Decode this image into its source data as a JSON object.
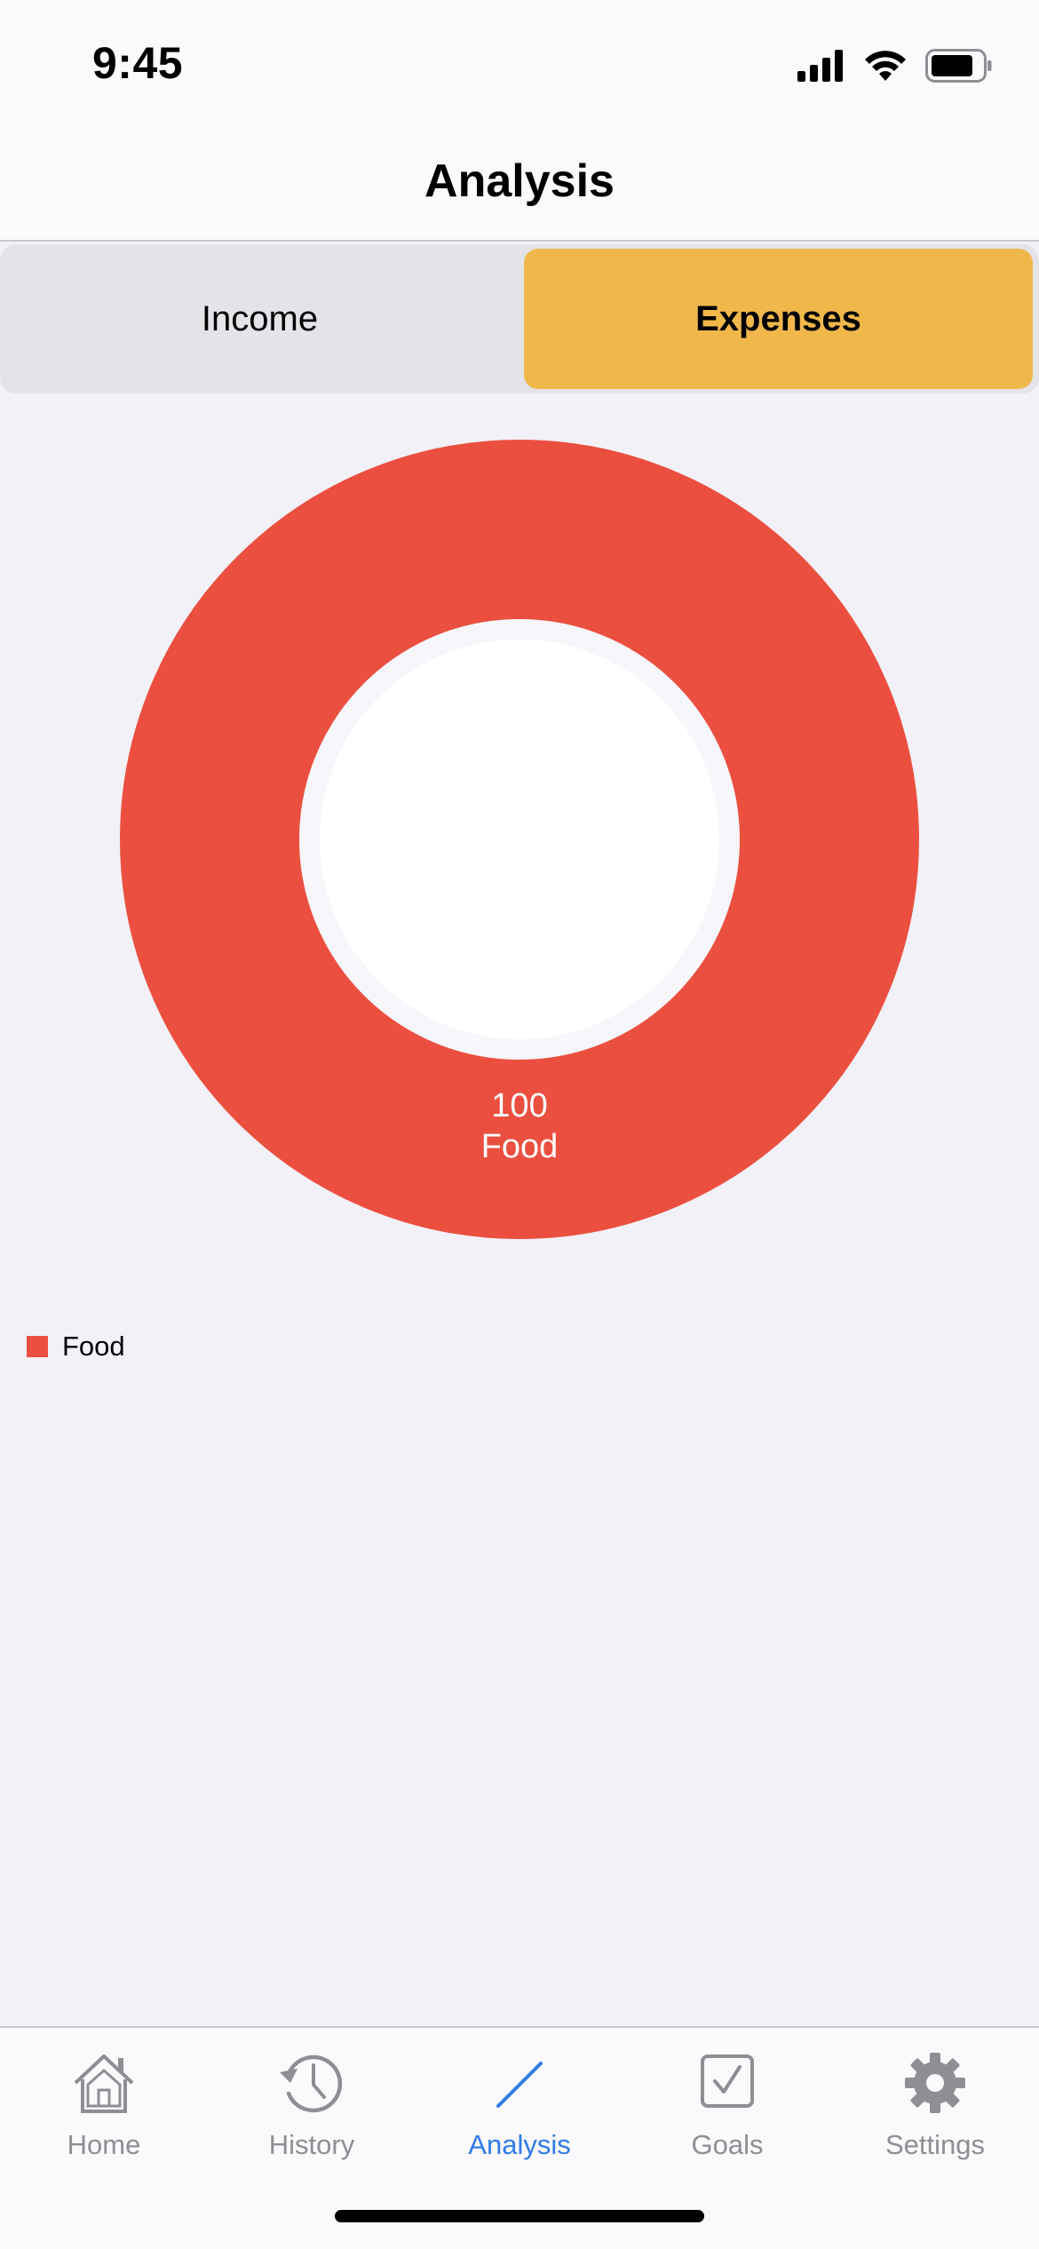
{
  "status_bar": {
    "time": "9:45"
  },
  "nav": {
    "title": "Analysis"
  },
  "segments": {
    "income_label": "Income",
    "expenses_label": "Expenses",
    "selected": "Expenses",
    "active_color": "#F0B84B"
  },
  "chart_data": {
    "type": "pie",
    "categories": [
      "Food"
    ],
    "values": [
      100
    ],
    "colors": [
      "#EB4F3F"
    ],
    "donut": true,
    "legend": "bottom-left",
    "slice_labels": [
      {
        "value": "100",
        "category": "Food"
      }
    ]
  },
  "legend": {
    "items": [
      {
        "label": "Food",
        "color": "#EB4F3F"
      }
    ]
  },
  "tab_bar": {
    "active_color": "#2F7BE8",
    "inactive_color": "#8E8E93",
    "items": [
      {
        "label": "Home",
        "icon": "house-icon"
      },
      {
        "label": "History",
        "icon": "clock-history-icon"
      },
      {
        "label": "Analysis",
        "icon": "chart-line-icon",
        "active": true
      },
      {
        "label": "Goals",
        "icon": "checkbox-icon"
      },
      {
        "label": "Settings",
        "icon": "gear-icon"
      }
    ]
  }
}
